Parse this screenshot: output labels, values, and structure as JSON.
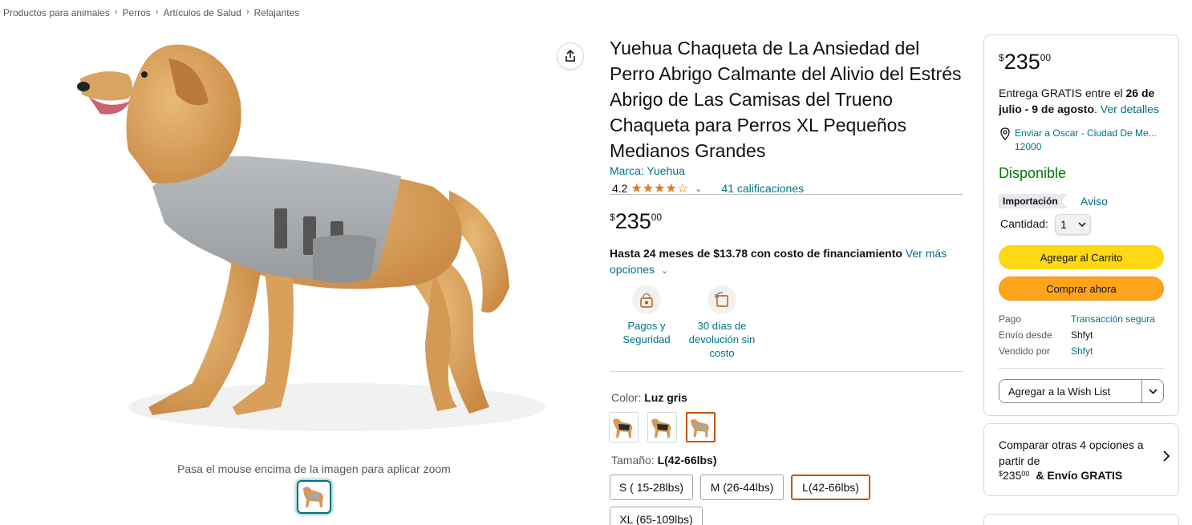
{
  "breadcrumb": [
    "Productos para animales",
    "Perros",
    "Artículos de Salud",
    "Relajantes"
  ],
  "breadcrumb_sep": "›",
  "image": {
    "zoom_hint": "Pasa el mouse encima de la imagen para aplicar zoom"
  },
  "product": {
    "title": "Yuehua Chaqueta de La Ansiedad del Perro Abrigo Calmante del Alivio del Estrés Abrigo de Las Camisas del Trueno Chaqueta para Perros XL Pequeños Medianos Grandes",
    "brand": "Marca: Yuehua",
    "rating": "4.2",
    "stars_full": 4,
    "ratings_count": "41 calificaciones",
    "price_symbol": "$",
    "price_whole": "235",
    "price_fraction": "00",
    "financing_bold": "Hasta 24 meses de $13.78 con costo de financiamiento",
    "financing_link": "Ver más opciones",
    "badges": [
      {
        "icon": "secure-payment-icon",
        "label": "Pagos y Seguridad"
      },
      {
        "icon": "return-icon",
        "label": "30 días de devolución sin costo"
      }
    ],
    "color_label": "Color:",
    "color_value": "Luz gris",
    "size_label": "Tamaño:",
    "size_value": "L(42-66lbs)",
    "sizes": [
      "S ( 15-28lbs)",
      "M (26-44lbs)",
      "L(42-66lbs)",
      "XL (65-109lbs)"
    ],
    "selected_size": "L(42-66lbs)"
  },
  "buybox": {
    "price_symbol": "$",
    "price_whole": "235",
    "price_fraction": "00",
    "delivery_prefix": "Entrega GRATIS entre el",
    "delivery_dates": "26 de julio - 9 de agosto",
    "delivery_link": "Ver detalles",
    "location_line1": "Enviar a Oscar - Ciudad De Me...",
    "location_line2": "12000",
    "availability": "Disponible",
    "import_tag": "Importación",
    "aviso": "Aviso",
    "qty_label": "Cantidad:",
    "qty_value": "1",
    "add_to_cart": "Agregar al Carrito",
    "buy_now": "Comprar ahora",
    "info": [
      {
        "key": "Pago",
        "value": "Transacción segura",
        "link": true
      },
      {
        "key": "Envío desde",
        "value": "Shfyt",
        "link": false
      },
      {
        "key": "Vendido por",
        "value": "Shfyt",
        "link": true
      }
    ],
    "wishlist": "Agregar a la Wish List"
  },
  "compare": {
    "text": "Comparar otras 4 opciones a partir de",
    "price_symbol": "$",
    "price_whole": "235",
    "price_fraction": "00",
    "shipping": "& Envío GRATIS"
  },
  "colors": {
    "link": "#007185",
    "cart": "#ffd814",
    "buy": "#ffa41c",
    "available": "#007600",
    "star": "#de7921"
  }
}
